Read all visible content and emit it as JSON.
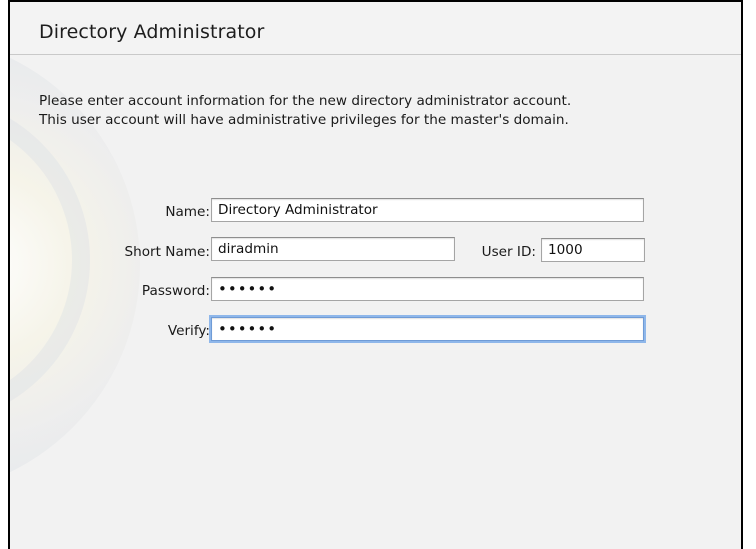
{
  "window": {
    "title": "Directory Administrator"
  },
  "intro": {
    "line1": "Please enter account information for the new directory administrator account.",
    "line2": "This user account will have administrative privileges for the master's domain."
  },
  "form": {
    "name": {
      "label": "Name:",
      "value": "Directory Administrator"
    },
    "short_name": {
      "label": "Short Name:",
      "value": "diradmin"
    },
    "user_id": {
      "label": "User ID:",
      "value": "1000"
    },
    "password": {
      "label": "Password:",
      "value": "••••••"
    },
    "verify": {
      "label": "Verify:",
      "value": "••••••"
    }
  },
  "colors": {
    "background": "#f2f2f2",
    "focus_ring": "#8fb7ea",
    "border": "#000000"
  }
}
